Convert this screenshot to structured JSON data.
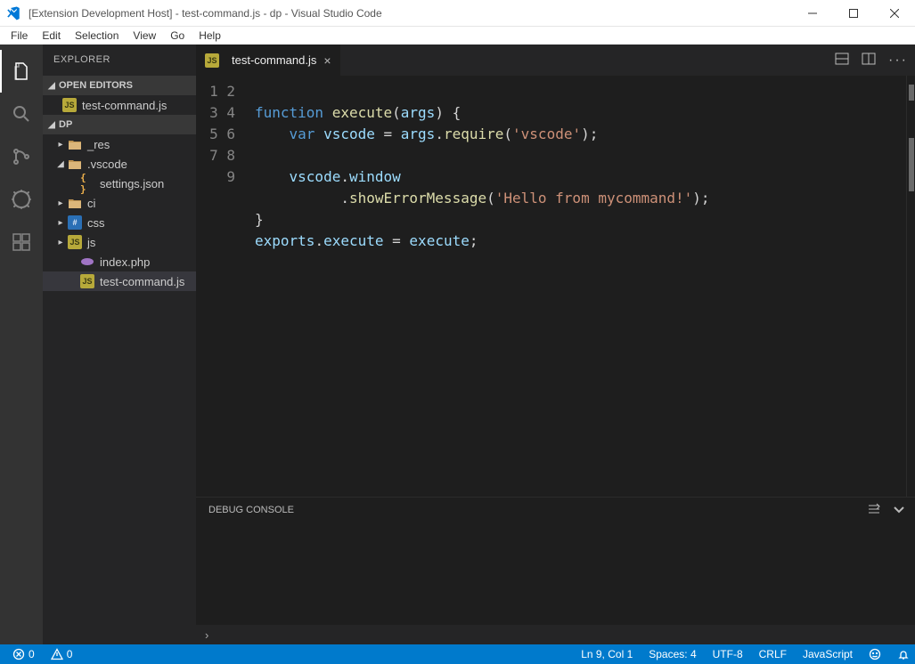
{
  "titlebar": {
    "title": "[Extension Development Host] - test-command.js - dp - Visual Studio Code"
  },
  "menu": [
    "File",
    "Edit",
    "Selection",
    "View",
    "Go",
    "Help"
  ],
  "activity": {
    "items": [
      "explorer",
      "search",
      "git",
      "debug",
      "extensions"
    ],
    "active": "explorer"
  },
  "sidebar": {
    "title": "EXPLORER",
    "section_open_editors": "OPEN EDITORS",
    "section_folder": "DP",
    "open_editors": [
      {
        "name": "test-command.js",
        "icon": "js"
      }
    ],
    "tree": [
      {
        "type": "folder",
        "name": "_res",
        "depth": 1,
        "open": false
      },
      {
        "type": "folder",
        "name": ".vscode",
        "depth": 1,
        "open": true
      },
      {
        "type": "file",
        "name": "settings.json",
        "icon": "json",
        "depth": 2
      },
      {
        "type": "folder",
        "name": "ci",
        "depth": 1,
        "open": false
      },
      {
        "type": "folder",
        "name": "css",
        "depth": 1,
        "open": false,
        "icon": "css"
      },
      {
        "type": "folder",
        "name": "js",
        "depth": 1,
        "open": false,
        "icon": "js"
      },
      {
        "type": "file",
        "name": "index.php",
        "icon": "php",
        "depth": 2
      },
      {
        "type": "file",
        "name": "test-command.js",
        "icon": "js",
        "depth": 2,
        "selected": true
      }
    ]
  },
  "tabs": {
    "open": [
      {
        "name": "test-command.js",
        "icon": "JS"
      }
    ]
  },
  "editor": {
    "lines": [
      1,
      2,
      3,
      4,
      5,
      6,
      7,
      8,
      9
    ],
    "code": [
      "",
      [
        [
          "kw",
          "function"
        ],
        [
          "punc",
          " "
        ],
        [
          "fn",
          "execute"
        ],
        [
          "punc",
          "("
        ],
        [
          "id",
          "args"
        ],
        [
          "punc",
          ") {"
        ]
      ],
      [
        [
          "punc",
          "    "
        ],
        [
          "kw",
          "var"
        ],
        [
          "punc",
          " "
        ],
        [
          "id",
          "vscode"
        ],
        [
          "punc",
          " = "
        ],
        [
          "id",
          "args"
        ],
        [
          "punc",
          "."
        ],
        [
          "fn",
          "require"
        ],
        [
          "punc",
          "("
        ],
        [
          "str",
          "'vscode'"
        ],
        [
          "punc",
          ");"
        ]
      ],
      "",
      [
        [
          "punc",
          "    "
        ],
        [
          "id",
          "vscode"
        ],
        [
          "punc",
          "."
        ],
        [
          "id",
          "window"
        ]
      ],
      [
        [
          "punc",
          "          ."
        ],
        [
          "fn",
          "showErrorMessage"
        ],
        [
          "punc",
          "("
        ],
        [
          "str",
          "'Hello from mycommand!'"
        ],
        [
          "punc",
          ");"
        ]
      ],
      [
        [
          "punc",
          "}"
        ]
      ],
      [
        [
          "id",
          "exports"
        ],
        [
          "punc",
          "."
        ],
        [
          "id",
          "execute"
        ],
        [
          "punc",
          " = "
        ],
        [
          "id",
          "execute"
        ],
        [
          "punc",
          ";"
        ]
      ],
      ""
    ]
  },
  "panel": {
    "title": "DEBUG CONSOLE"
  },
  "breadcrumb": {
    "chevron": "›"
  },
  "status": {
    "errors": "0",
    "warnings": "0",
    "ln": "Ln 9, Col 1",
    "spaces": "Spaces: 4",
    "enc": "UTF-8",
    "eol": "CRLF",
    "lang": "JavaScript"
  }
}
